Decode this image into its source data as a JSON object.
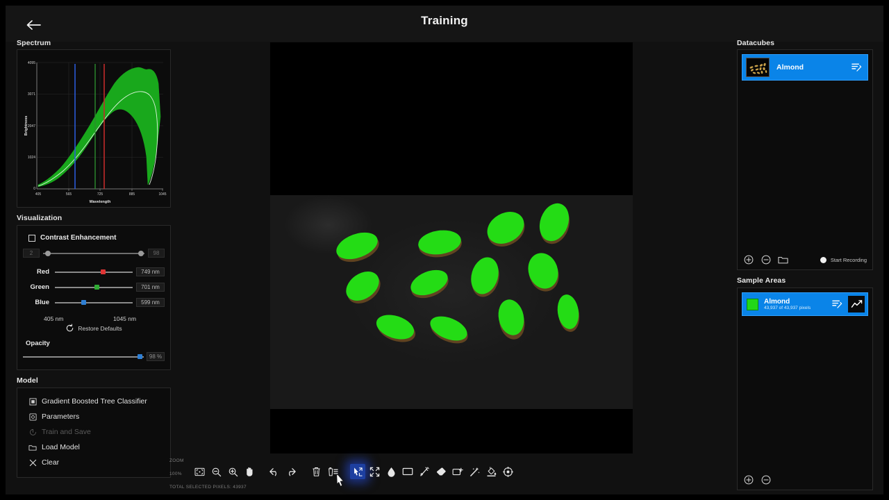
{
  "header": {
    "title": "Training",
    "back_icon": "arrow-left-icon"
  },
  "left_panel": {
    "spectrum": {
      "title": "Spectrum"
    },
    "visualization": {
      "title": "Visualization",
      "contrast_enhancement_label": "Contrast Enhancement",
      "contrast_min": "2",
      "contrast_max": "98",
      "channels": [
        {
          "label": "Red",
          "value": "749 nm",
          "color": "#e03535",
          "pos_pct": 61
        },
        {
          "label": "Green",
          "value": "701 nm",
          "color": "#2faa33",
          "pos_pct": 53
        },
        {
          "label": "Blue",
          "value": "599 nm",
          "color": "#2e7fd4",
          "pos_pct": 37
        }
      ],
      "range_min_label": "405 nm",
      "range_max_label": "1045 nm",
      "restore_defaults_label": "Restore Defaults",
      "opacity_label": "Opacity",
      "opacity_value": "98 %"
    },
    "model": {
      "title": "Model",
      "items": [
        {
          "label": "Gradient Boosted Tree Classifier",
          "icon": "classifier-icon",
          "disabled": false
        },
        {
          "label": "Parameters",
          "icon": "parameters-icon",
          "disabled": false
        },
        {
          "label": "Train and Save",
          "icon": "train-icon",
          "disabled": true
        },
        {
          "label": "Load Model",
          "icon": "folder-icon",
          "disabled": false
        },
        {
          "label": "Clear",
          "icon": "close-icon",
          "disabled": false
        }
      ]
    }
  },
  "bottom_bar": {
    "zoom_label": "ZOOM",
    "zoom_value": "100%",
    "selected_pixels_label": "TOTAL SELECTED PIXELS: 43937",
    "tools": [
      {
        "name": "fit-to-screen-icon",
        "active": false
      },
      {
        "name": "zoom-out-icon",
        "active": false
      },
      {
        "name": "zoom-in-icon",
        "active": false
      },
      {
        "name": "pan-hand-icon",
        "active": false
      },
      {
        "name": "undo-icon",
        "active": false
      },
      {
        "name": "redo-icon",
        "active": false
      },
      {
        "name": "delete-icon",
        "active": false
      },
      {
        "name": "delete-list-icon",
        "active": false
      },
      {
        "name": "select-pointer-icon",
        "active": true
      },
      {
        "name": "shrink-selection-icon",
        "active": false
      },
      {
        "name": "threshold-icon",
        "active": false
      },
      {
        "name": "rectangle-select-icon",
        "active": false
      },
      {
        "name": "polygon-select-icon",
        "active": false
      },
      {
        "name": "eraser-icon",
        "active": false
      },
      {
        "name": "add-region-icon",
        "active": false
      },
      {
        "name": "magic-wand-icon",
        "active": false
      },
      {
        "name": "fill-bucket-icon",
        "active": false
      },
      {
        "name": "target-icon",
        "active": false
      }
    ]
  },
  "right_panel": {
    "datacubes": {
      "title": "Datacubes",
      "items": [
        {
          "name": "Almond",
          "edit_icon": "edit-list-icon",
          "thumbnail": "almond-thumbnail"
        }
      ],
      "add_icon": "add-circle-icon",
      "remove_icon": "remove-circle-icon",
      "open_icon": "folder-icon",
      "record_label": "Start Recording",
      "record_icon": "record-dot-icon"
    },
    "sample_areas": {
      "title": "Sample Areas",
      "items": [
        {
          "name": "Almond",
          "pixels": "43,937 of 43,937 pixels",
          "color": "#22d717",
          "edit_icon": "edit-list-icon",
          "graph_icon": "line-chart-icon"
        }
      ],
      "add_icon": "add-circle-icon",
      "remove_icon": "remove-circle-icon"
    }
  },
  "chart_data": {
    "type": "area",
    "title": "Spectrum",
    "xlabel": "Wavelength",
    "ylabel": "Brightness",
    "x_ticks": [
      "405",
      "565",
      "725",
      "885",
      "1045"
    ],
    "y_ticks": [
      "0",
      "1024",
      "2047",
      "3071",
      "4095"
    ],
    "xlim": [
      405,
      1045
    ],
    "ylim": [
      0,
      4095
    ],
    "grid": true,
    "series": [
      {
        "name": "mean",
        "color": "#d6f5d6",
        "x": [
          405,
          445,
          485,
          525,
          565,
          605,
          645,
          685,
          725,
          765,
          805,
          845,
          885,
          925,
          965,
          1005,
          1030,
          1045
        ],
        "values": [
          60,
          110,
          190,
          330,
          560,
          860,
          1220,
          1620,
          2050,
          2460,
          2810,
          3020,
          3120,
          3150,
          3110,
          2890,
          2300,
          900
        ]
      },
      {
        "name": "upper-envelope",
        "color": "#19a81c",
        "x": [
          405,
          445,
          485,
          525,
          565,
          605,
          645,
          685,
          725,
          765,
          805,
          845,
          885,
          925,
          965,
          1005,
          1030,
          1045
        ],
        "values": [
          140,
          220,
          350,
          560,
          880,
          1280,
          1740,
          2230,
          2720,
          3180,
          3520,
          3720,
          3800,
          3760,
          3790,
          3580,
          3000,
          1150
        ]
      },
      {
        "name": "lower-envelope",
        "color": "#19a81c",
        "x": [
          405,
          445,
          485,
          525,
          565,
          605,
          645,
          685,
          725,
          765,
          805,
          845,
          885,
          925,
          965,
          1005,
          1030,
          1045
        ],
        "values": [
          20,
          50,
          90,
          160,
          290,
          470,
          700,
          960,
          1260,
          1580,
          1880,
          2120,
          2290,
          2360,
          2330,
          2140,
          1600,
          500
        ]
      }
    ],
    "markers": [
      {
        "name": "blue-wavelength-marker",
        "x": 599,
        "color": "#2a5bd7"
      },
      {
        "name": "green-wavelength-marker",
        "x": 701,
        "color": "#2c8c2f"
      },
      {
        "name": "red-wavelength-marker",
        "x": 749,
        "color": "#c22a2a"
      }
    ]
  }
}
